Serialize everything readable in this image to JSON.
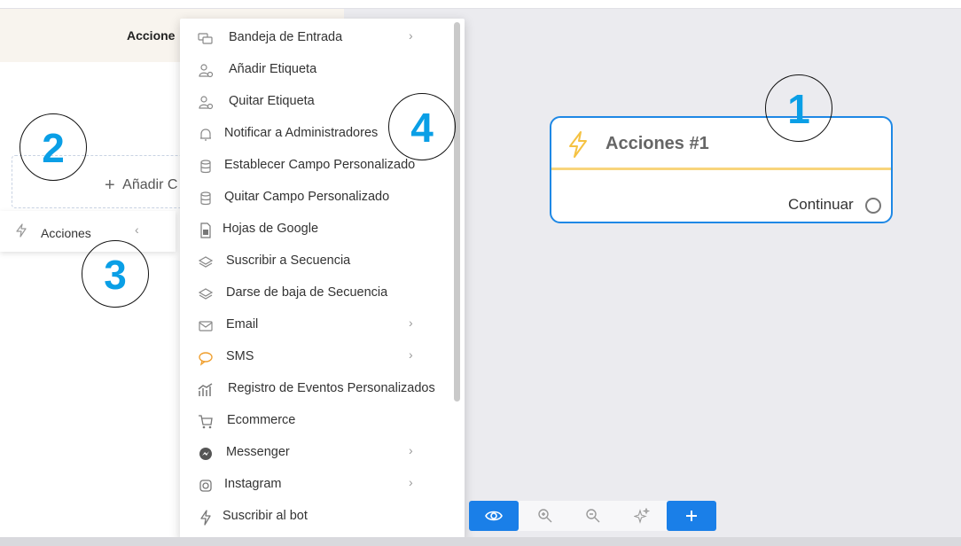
{
  "left_panel": {
    "header_title": "Accione",
    "add_button_label": "Añadir C",
    "acciones_row_label": "Acciones"
  },
  "annotations": [
    "1",
    "2",
    "3",
    "4"
  ],
  "node": {
    "title": "Acciones #1",
    "continue_label": "Continuar",
    "accent_color": "#1e88e5",
    "divider_color": "#f8d57c"
  },
  "menu": {
    "items": [
      {
        "label": "Bandeja de Entrada",
        "icon": "chat-icon",
        "submenu": true
      },
      {
        "label": "Añadir Etiqueta",
        "icon": "user-tag-icon",
        "submenu": false
      },
      {
        "label": "Quitar Etiqueta",
        "icon": "user-tag-icon",
        "submenu": false
      },
      {
        "label": "Notificar a Administradores",
        "icon": "bell-icon",
        "submenu": false
      },
      {
        "label": "Establecer Campo Personalizado",
        "icon": "database-icon",
        "submenu": false
      },
      {
        "label": "Quitar Campo Personalizado",
        "icon": "database-icon",
        "submenu": false
      },
      {
        "label": "Hojas de Google",
        "icon": "sheet-icon",
        "submenu": false
      },
      {
        "label": "Suscribir a Secuencia",
        "icon": "layers-icon",
        "submenu": false
      },
      {
        "label": "Darse de baja de Secuencia",
        "icon": "layers-icon",
        "submenu": false
      },
      {
        "label": "Email",
        "icon": "mail-icon",
        "submenu": true
      },
      {
        "label": "SMS",
        "icon": "sms-icon",
        "submenu": true
      },
      {
        "label": "Registro de Eventos Personalizados",
        "icon": "chart-icon",
        "submenu": false
      },
      {
        "label": "Ecommerce",
        "icon": "cart-icon",
        "submenu": false
      },
      {
        "label": "Messenger",
        "icon": "messenger-icon",
        "submenu": true
      },
      {
        "label": "Instagram",
        "icon": "instagram-icon",
        "submenu": true
      },
      {
        "label": "Suscribir al bot",
        "icon": "bolt-icon",
        "submenu": false
      }
    ]
  },
  "toolbar": {
    "buttons": [
      "eye-icon",
      "zoom-in-icon",
      "zoom-out-icon",
      "sparkle-icon",
      "plus-icon"
    ]
  }
}
